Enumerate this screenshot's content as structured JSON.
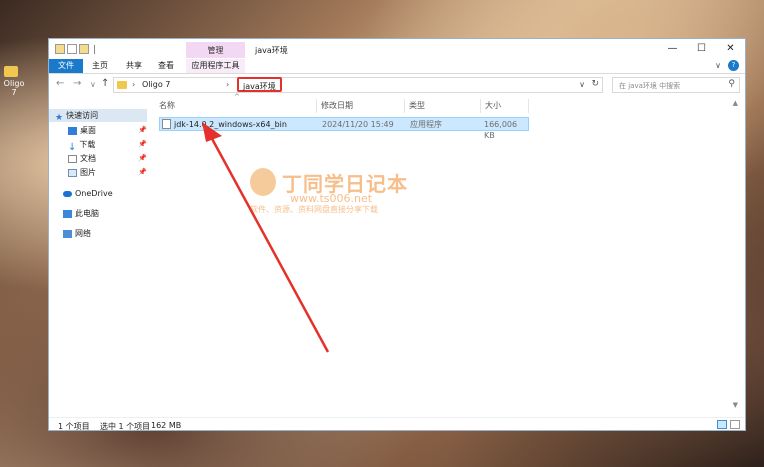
{
  "desktop": {
    "icon_label": "Oligo 7"
  },
  "window": {
    "context_tab_title": "管理",
    "title": "java环境",
    "controls": {
      "minimize": "—",
      "maximize": "☐",
      "close": "✕"
    }
  },
  "ribbon": {
    "tabs": [
      "文件",
      "主页",
      "共享",
      "查看",
      "应用程序工具"
    ],
    "expand": "∨",
    "help": "?"
  },
  "address": {
    "back": "←",
    "forward": "→",
    "recent": "∨",
    "up": "↑",
    "sep": "›",
    "crumbs": [
      "Oligo 7",
      "java环境"
    ],
    "dropdown": "∨",
    "refresh": "↻",
    "search_placeholder": "在 java环境 中搜索",
    "search_icon": "⚲"
  },
  "nav_pane": {
    "items": [
      {
        "label": "快速访问",
        "icon": "star-icon"
      },
      {
        "label": "桌面",
        "icon": "desktop-icon"
      },
      {
        "label": "下载",
        "icon": "download-icon"
      },
      {
        "label": "文档",
        "icon": "document-icon"
      },
      {
        "label": "图片",
        "icon": "picture-icon"
      },
      {
        "label": "OneDrive",
        "icon": "cloud-icon"
      },
      {
        "label": "此电脑",
        "icon": "computer-icon"
      },
      {
        "label": "网络",
        "icon": "network-icon"
      }
    ],
    "pin": "📌"
  },
  "file_list": {
    "columns": [
      "名称",
      "修改日期",
      "类型",
      "大小"
    ],
    "sort_indicator": "^",
    "rows": [
      {
        "name": "jdk-14.0.2_windows-x64_bin",
        "modified": "2024/11/20 15:49",
        "type": "应用程序",
        "size": "166,006 KB"
      }
    ]
  },
  "status": {
    "count": "1 个项目",
    "selected": "选中 1 个项目",
    "size": "162 MB"
  },
  "scroll": {
    "up": "▲",
    "down": "▼"
  },
  "watermark": {
    "title": "丁同学日记本",
    "url": "www.ts006.net",
    "subtitle": "软件、资源、资料网盘直接分享下载"
  },
  "colors": {
    "accent": "#1979ca",
    "selection": "#cce8ff",
    "highlight": "#e5312b",
    "context_tab": "#f2d8f3"
  }
}
